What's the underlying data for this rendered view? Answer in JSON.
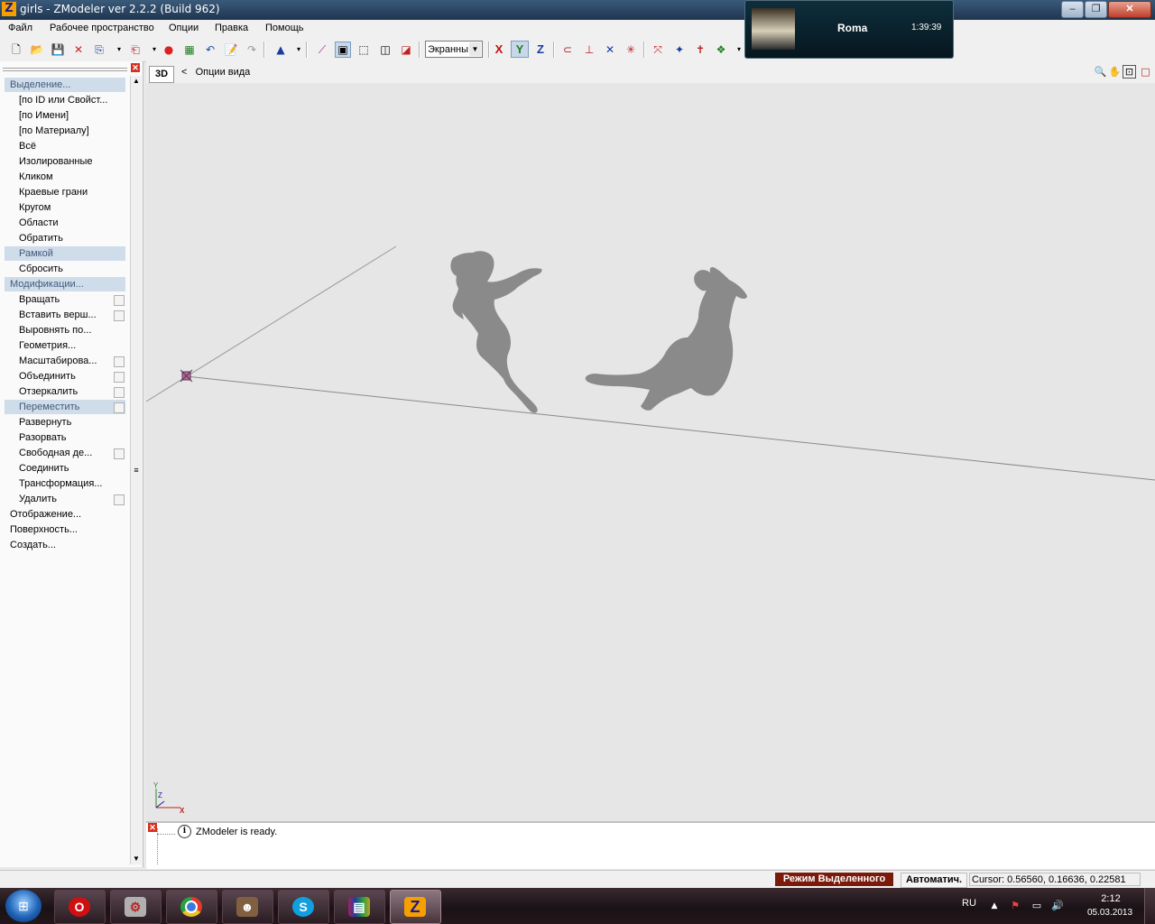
{
  "window": {
    "title": "girls - ZModeler ver 2.2.2 (Build 962)",
    "app_icon_letter": "Z"
  },
  "menu": [
    "Файл",
    "Рабочее пространство",
    "Опции",
    "Правка",
    "Помощь"
  ],
  "toolbar": {
    "screen_combo": "Экранны",
    "axes": [
      "X",
      "Y",
      "Z"
    ]
  },
  "notification": {
    "name": "Roma",
    "time": "1:39:39"
  },
  "left_panel": {
    "selection_header": "Выделение...",
    "selection_items": [
      "[по ID или Свойст...",
      "[по Имени]",
      "[по Материалу]",
      "Всё",
      "Изолированные",
      "Кликом",
      "Краевые грани",
      "Кругом",
      "Области",
      "Обратить",
      "Рамкой",
      "Сбросить"
    ],
    "selection_active": "Рамкой",
    "modify_header": "Модификации...",
    "modify_items": [
      "Вращать",
      "Вставить верш...",
      "Выровнять по...",
      "Геометрия...",
      "Масштабирова...",
      "Объединить",
      "Отзеркалить",
      "Переместить",
      "Развернуть",
      "Разорвать",
      "Свободная де...",
      "Соединить",
      "Трансформация...",
      "Удалить"
    ],
    "modify_active": "Переместить",
    "groups": [
      "Отображение...",
      "Поверхность...",
      "Создать..."
    ]
  },
  "viewport": {
    "mode_button": "3D",
    "back_arrow": "<",
    "view_options": "Опции вида",
    "axis_labels": {
      "y": "Y",
      "z": "Z",
      "x": "X"
    }
  },
  "log": {
    "message": "ZModeler is ready.",
    "info_icon": "i"
  },
  "status": {
    "mode": "Режим Выделенного",
    "auto": "Автоматич.",
    "cursor": "Cursor: 0.56560, 0.16636, 0.22581"
  },
  "taskbar": {
    "apps": [
      "opera",
      "game-launcher",
      "chrome",
      "gta-player",
      "skype",
      "winrar",
      "zmodeler"
    ],
    "lang": "RU",
    "time": "2:12",
    "date": "05.03.2013"
  },
  "colors": {
    "accent": "#cfdcea",
    "mode_badge": "#7a1a0a",
    "model_fill": "#8a8a8a",
    "viewport_bg": "#e6e6e6"
  }
}
